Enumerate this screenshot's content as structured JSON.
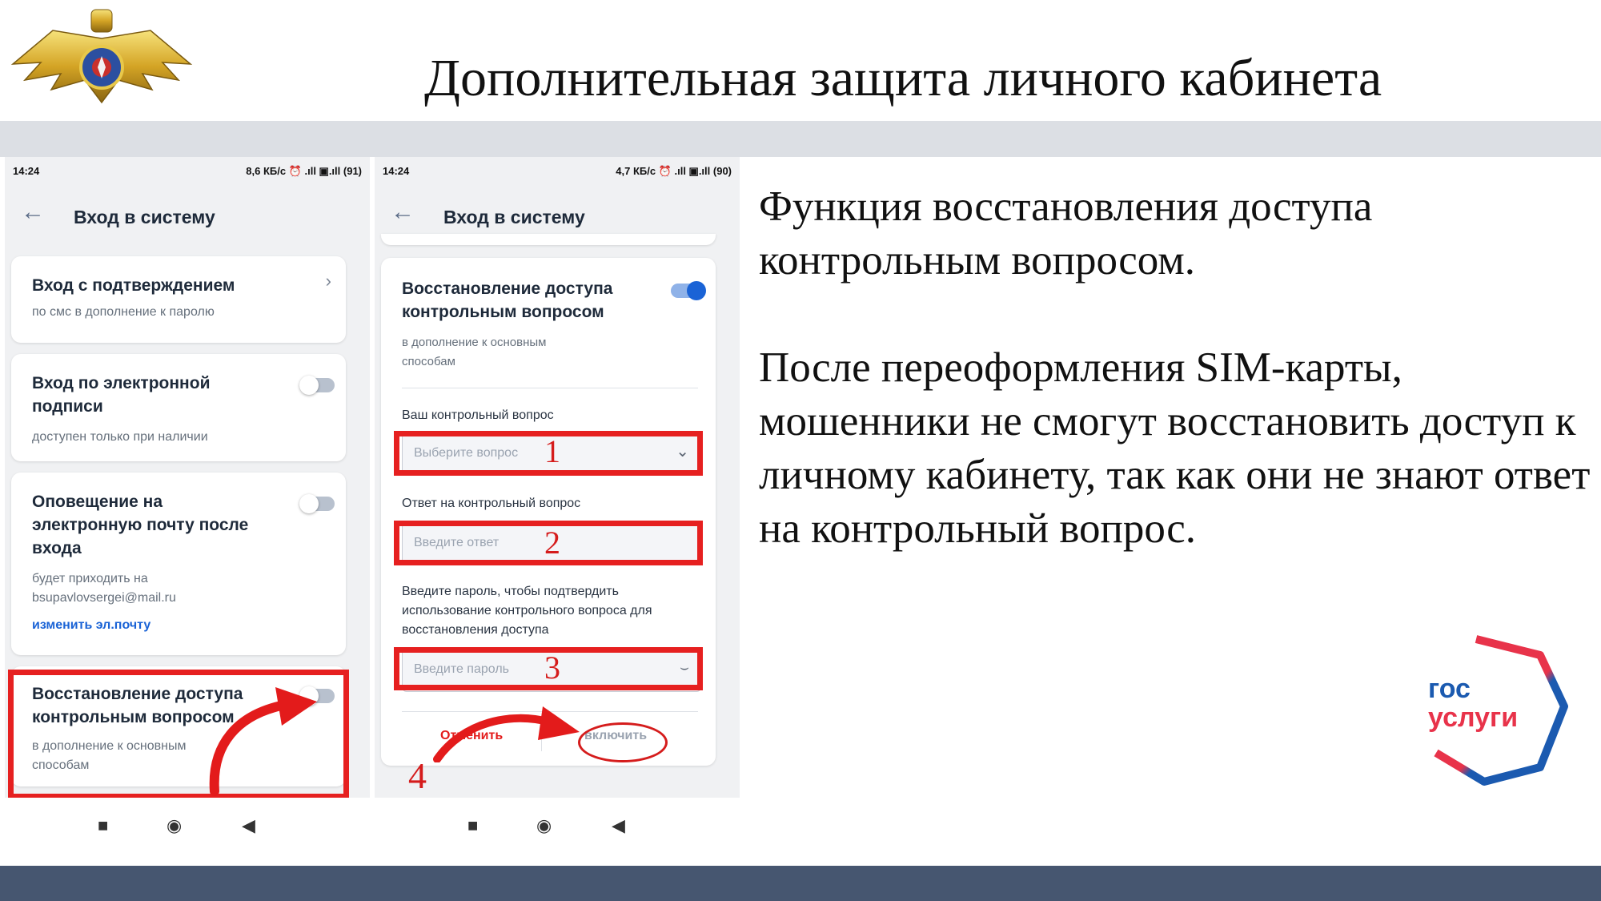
{
  "slide": {
    "title": "Дополнительная защита личного кабинета",
    "paragraph1": "Функция восстановления доступа контрольным вопросом.",
    "paragraph2": "После переоформления SIM-карты, мошенники не смогут восстановить доступ к личному кабинету, так как они не знают ответ на контрольный вопрос."
  },
  "phone1": {
    "status_time": "14:24",
    "status_right": "8,6 КБ/с ⏰ .ıll ▣.ıll (91)",
    "app_title": "Вход в систему",
    "cards": [
      {
        "title": "Вход с подтверждением",
        "subtitle": "по смс в дополнение к паролю"
      },
      {
        "title_line1": "Вход по электронной",
        "title_line2": "подписи",
        "subtitle": "доступен только при наличии"
      },
      {
        "title_line1": "Оповещение на",
        "title_line2": "электронную почту после",
        "title_line3": "входа",
        "subtitle_line1": "будет приходить на",
        "subtitle_line2": "bsupavlovsergei@mail.ru",
        "link": "изменить эл.почту"
      },
      {
        "title_line1": "Восстановление доступа",
        "title_line2": "контрольным вопросом",
        "subtitle_line1": "в дополнение к основным",
        "subtitle_line2": "способам"
      }
    ]
  },
  "phone2": {
    "status_time": "14:24",
    "status_right": "4,7 КБ/с ⏰ .ıll ▣.ıll (90)",
    "app_title": "Вход в систему",
    "card_title_line1": "Восстановление доступа",
    "card_title_line2": "контрольным вопросом",
    "card_subtitle_line1": "в дополнение к основным",
    "card_subtitle_line2": "способам",
    "question_label": "Ваш контрольный вопрос",
    "question_placeholder": "Выберите вопрос",
    "answer_label": "Ответ на контрольный вопрос",
    "answer_placeholder": "Введите ответ",
    "password_label_line1": "Введите пароль, чтобы подтвердить",
    "password_label_line2": "использование контрольного вопроса для",
    "password_label_line3": "восстановления доступа",
    "password_placeholder": "Введите  пароль",
    "cancel_label": "Отменить",
    "enable_label": "включить"
  },
  "annotations": {
    "n1": "1",
    "n2": "2",
    "n3": "3",
    "n4": "4"
  },
  "brand": {
    "line1": "гос",
    "line2": "услуги"
  },
  "colors": {
    "accent_red": "#e62020",
    "toggle_blue": "#1a63d6",
    "band_dark": "#465670",
    "band_light": "#dcdfe4"
  }
}
